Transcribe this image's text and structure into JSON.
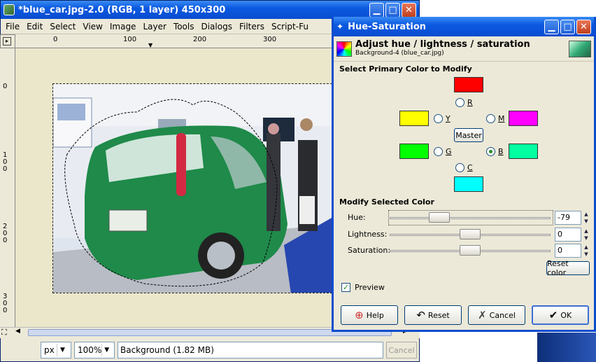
{
  "main_window": {
    "title": "*blue_car.jpg-2.0 (RGB, 1 layer) 450x300",
    "menu": [
      "File",
      "Edit",
      "Select",
      "View",
      "Image",
      "Layer",
      "Tools",
      "Dialogs",
      "Filters",
      "Script-Fu"
    ],
    "ruler_top": [
      "0",
      "100",
      "200",
      "300"
    ],
    "ruler_left": [
      "0",
      "100",
      "200",
      "300"
    ],
    "unit": "px",
    "zoom": "100%",
    "status": "Background (1.82 MB)",
    "cancel": "Cancel"
  },
  "dialog": {
    "title": "Hue-Saturation",
    "heading": "Adjust hue / lightness / saturation",
    "subheading": "Background-4 (blue_car.jpg)",
    "primary_section": "Select Primary Color to Modify",
    "colors": {
      "R": {
        "label": "R",
        "hex": "#ff0000"
      },
      "Y": {
        "label": "Y",
        "hex": "#ffff00"
      },
      "G": {
        "label": "G",
        "hex": "#00ff00"
      },
      "C": {
        "label": "C",
        "hex": "#00ffff"
      },
      "B": {
        "label": "B",
        "hex": "#00ffa0"
      },
      "M": {
        "label": "M",
        "hex": "#ff00ff"
      }
    },
    "selected_color": "B",
    "master_button": "Master",
    "modify_section": "Modify Selected Color",
    "sliders": {
      "hue": {
        "label": "Hue:",
        "value": "-79",
        "min": -180,
        "max": 180
      },
      "lightness": {
        "label": "Lightness:",
        "value": "0",
        "min": -100,
        "max": 100
      },
      "saturation": {
        "label": "Saturation:",
        "value": "0",
        "min": -100,
        "max": 100
      }
    },
    "reset_color": "Reset color",
    "preview_label": "Preview",
    "preview_checked": true,
    "buttons": {
      "help": "Help",
      "reset": "Reset",
      "cancel": "Cancel",
      "ok": "OK"
    }
  }
}
